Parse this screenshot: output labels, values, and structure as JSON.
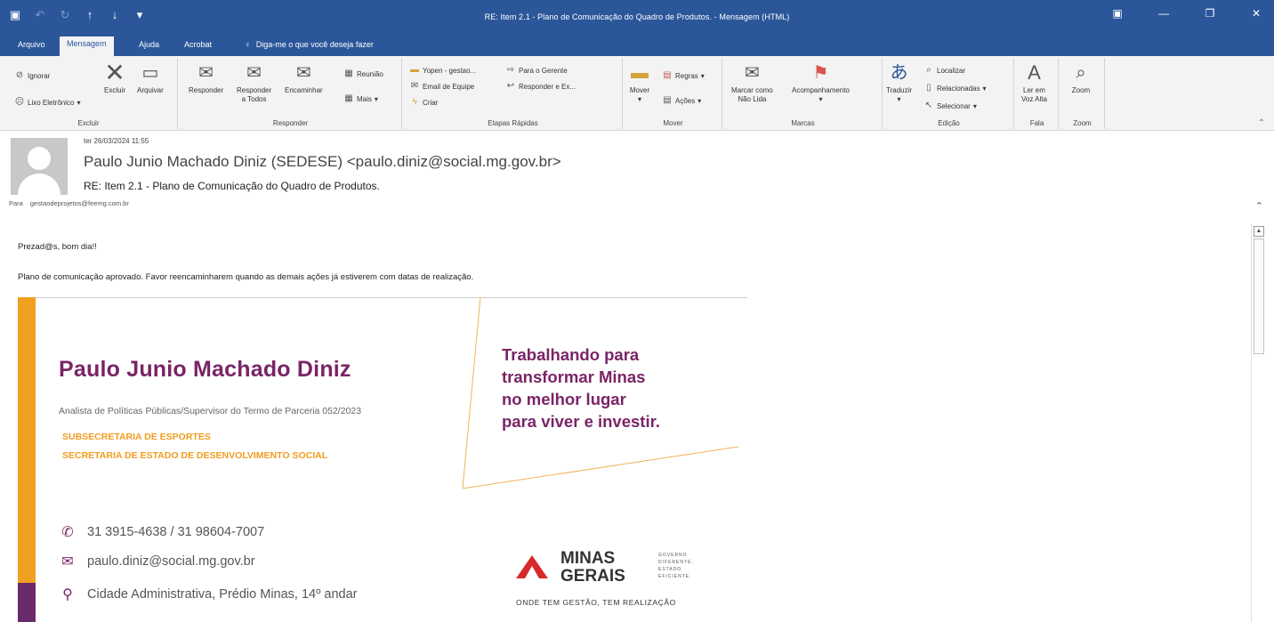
{
  "window": {
    "title": "RE: Item 2.1 - Plano de Comunicação do Quadro de Produtos. - Mensagem (HTML)",
    "qat_icons": [
      "save-icon",
      "undo-icon",
      "redo-icon",
      "up-arrow-icon",
      "down-arrow-icon",
      "customize-icon"
    ],
    "controls": [
      "restore-ribbon-icon",
      "minimize-icon",
      "restore-icon",
      "close-icon"
    ]
  },
  "menu": {
    "tabs": [
      "Arquivo",
      "Mensagem",
      "Ajuda",
      "Acrobat"
    ],
    "active_tab": "Mensagem",
    "tell_me": "Diga-me o que você deseja fazer"
  },
  "ribbon": {
    "excluir": {
      "ignorar": "Ignorar",
      "lixo": "Lixo Eletrônico",
      "excluir": "Excluir",
      "arquivar": "Arquivar",
      "label": "Excluir"
    },
    "responder": {
      "responder": "Responder",
      "responder_todos_1": "Responder",
      "responder_todos_2": "a Todos",
      "encaminhar": "Encaminhar",
      "reuniao": "Reunião",
      "mais": "Mais",
      "label": "Responder"
    },
    "etapas": {
      "items": [
        "Yopen - gestao...",
        "Para o Gerente",
        "Email de Equipe",
        "Responder e Ex...",
        "Criar"
      ],
      "label": "Etapas Rápidas"
    },
    "mover": {
      "mover": "Mover",
      "regras": "Regras",
      "acoes": "Ações",
      "label": "Mover"
    },
    "marcas": {
      "marcar_1": "Marcar como",
      "marcar_2": "Não Lida",
      "acompanhamento": "Acompanhamento",
      "label": "Marcas"
    },
    "edicao": {
      "traduzir": "Traduzir",
      "localizar": "Localizar",
      "relacionadas": "Relacionadas",
      "selecionar": "Selecionar",
      "label": "Edição"
    },
    "fala": {
      "ler_1": "Ler em",
      "ler_2": "Voz Alta",
      "label": "Fala"
    },
    "zoom": {
      "zoom": "Zoom",
      "label": "Zoom"
    }
  },
  "message": {
    "date": "ter 26/03/2024 11:55",
    "from": "Paulo Junio Machado Diniz (SEDESE) <paulo.diniz@social.mg.gov.br>",
    "subject": "RE: Item 2.1 - Plano de Comunicação do Quadro de Produtos.",
    "to_label": "Para",
    "to": "gestaodeprojetos@feemg.com.br",
    "greeting": "Prezad@s, bom dia!!",
    "text": "Plano de comunicação aprovado. Favor reencaminharem quando as demais ações já estiverem com datas de realização."
  },
  "signature": {
    "name": "Paulo Junio Machado Diniz",
    "role": "Analista de Políticas Públicas/Supervisor do Termo de Parceria 052/2023",
    "org1": "SUBSECRETARIA DE ESPORTES",
    "org2": "SECRETARIA DE ESTADO DE DESENVOLVIMENTO SOCIAL",
    "slogan": [
      "Trabalhando para",
      "transformar Minas",
      "no melhor lugar",
      "para viver e investir."
    ],
    "phone": "31 3915-4638 / 31 98604-7007",
    "email": "paulo.diniz@social.mg.gov.br",
    "address": "Cidade Administrativa, Prédio Minas, 14º andar",
    "logo_line1": "MINAS",
    "logo_line2": "GERAIS",
    "logo_side": [
      "GOVERNO",
      "DIFERENTE.",
      "ESTADO",
      "EFICIENTE."
    ],
    "logo_tag": "ONDE TEM GESTÃO, TEM REALIZAÇÃO",
    "colors": {
      "purple": "#7a2466",
      "orange": "#f29c1f"
    }
  }
}
